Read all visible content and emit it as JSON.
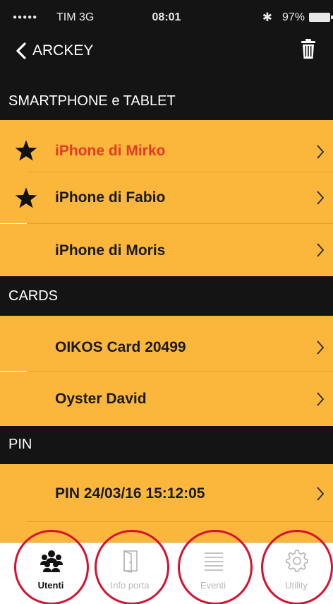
{
  "status_bar": {
    "signal_dots": "●●●●●",
    "carrier": "TIM  3G",
    "time": "08:01",
    "bluetooth": "✱",
    "battery": "97%"
  },
  "nav": {
    "back_label": "ARCKEY",
    "back_icon": "chevron-left-icon",
    "trash_icon": "trash-icon"
  },
  "sections": [
    {
      "title": "SMARTPHONE e TABLET",
      "items": [
        {
          "label": "iPhone di Mirko",
          "starred": true,
          "color": "#e53a26"
        },
        {
          "label": "iPhone di Fabio",
          "starred": true
        },
        {
          "label": "iPhone di Moris",
          "starred": false
        }
      ]
    },
    {
      "title": "CARDS",
      "items": [
        {
          "label": "OIKOS Card 20499",
          "starred": false
        },
        {
          "label": "Oyster David",
          "starred": false
        }
      ]
    },
    {
      "title": "PIN",
      "items": [
        {
          "label": "PIN 24/03/16 15:12:05",
          "starred": false
        }
      ]
    }
  ],
  "tabbar": {
    "tabs": [
      {
        "label": "Utenti",
        "icon": "users-icon",
        "active": true
      },
      {
        "label": "Info porta",
        "icon": "door-icon",
        "active": false
      },
      {
        "label": "Eventi",
        "icon": "list-icon",
        "active": false
      },
      {
        "label": "Utility",
        "icon": "gear-icon",
        "active": false
      }
    ]
  },
  "colors": {
    "row_background": "#fbb73b",
    "header_background": "#141414",
    "highlight_circle": "#d8102f",
    "selected_item_text": "#e53a26"
  }
}
